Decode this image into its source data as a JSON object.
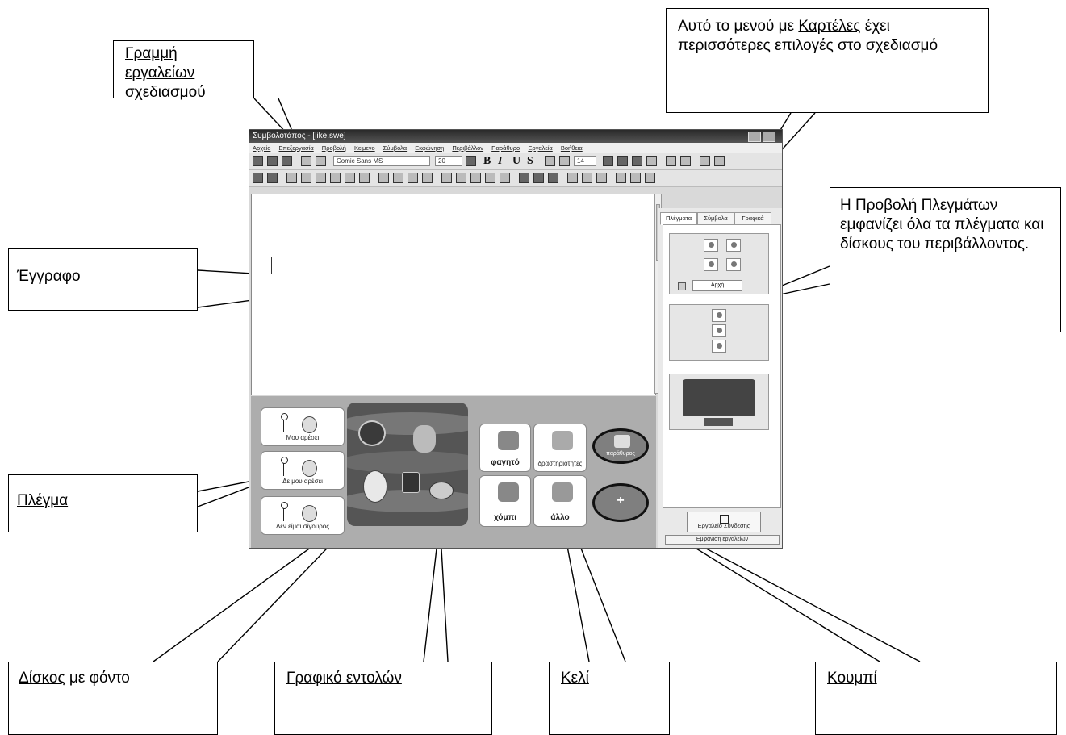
{
  "callouts": {
    "toolbar": "Γραμμή εργαλείων σχεδιασμού",
    "tabs_prefix": "Αυτό το μενού με",
    "tabs_link": "Καρτέλες",
    "tabs_suffix": "έχει περισσότερες επιλογές στο σχεδιασμό",
    "gridview_prefix": "Η",
    "gridview_link": "Προβολή Πλεγμάτων",
    "gridview_suffix": "εμφανίζει όλα τα πλέγματα και δίσκους του περιβάλλοντος.",
    "document": "Έγγραφο",
    "grid": "Πλέγμα",
    "disk_link": "Δίσκος",
    "disk_suffix": "με φόντο",
    "command_graphic": "Γραφικό εντολών",
    "cell": "Κελί",
    "button": "Κουμπί"
  },
  "app": {
    "title": "Συμβολοτάπος - [like.swe]",
    "menu": [
      "Αρχείο",
      "Επεξεργασία",
      "Προβολή",
      "Κείμενο",
      "Σύμβολα",
      "Εκφώνηση",
      "Περιβάλλον",
      "Παράθυρο",
      "Εργαλεία",
      "Βοήθεια"
    ],
    "font_name": "Comic Sans MS",
    "font_size": "20",
    "line_spacing": "14",
    "bold": "B",
    "italic": "I",
    "underline": "U",
    "strike": "S",
    "panel_tabs": [
      "Πλέγματα",
      "Σύμβολα",
      "Γραφικά"
    ],
    "start_label": "Αρχή",
    "link_tool": "Εργαλείο Σύνδεσης",
    "show_tools": "Εμφάνιση εργαλείων",
    "cells": {
      "like": "Μου αρέσει",
      "dislike": "Δε μου αρέσει",
      "unsure": "Δεν είμαι σίγουρος",
      "food": "φαγητό",
      "activities": "δραστηριότητες",
      "hobby": "χόμπι",
      "other": "άλλο",
      "window": "παράθυρος",
      "more": "+"
    }
  },
  "colors": {
    "text": "#000000",
    "window_bg": "#d9d9d9",
    "grid_bg": "#adadad"
  }
}
